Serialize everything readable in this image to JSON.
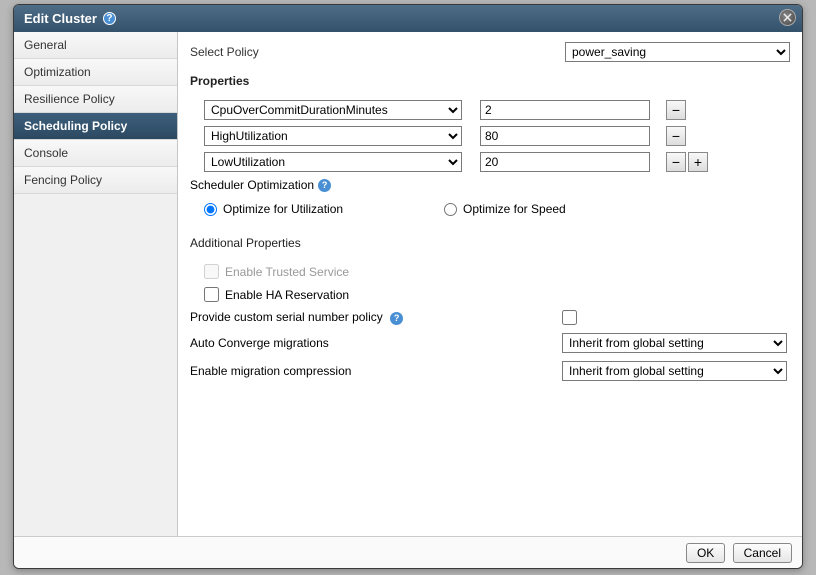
{
  "dialog": {
    "title": "Edit Cluster"
  },
  "sidebar": {
    "items": [
      {
        "label": "General"
      },
      {
        "label": "Optimization"
      },
      {
        "label": "Resilience Policy"
      },
      {
        "label": "Scheduling Policy"
      },
      {
        "label": "Console"
      },
      {
        "label": "Fencing Policy"
      }
    ]
  },
  "content": {
    "select_policy_label": "Select Policy",
    "select_policy_value": "power_saving",
    "properties_title": "Properties",
    "prop_rows": [
      {
        "name": "CpuOverCommitDurationMinutes",
        "value": "2"
      },
      {
        "name": "HighUtilization",
        "value": "80"
      },
      {
        "name": "LowUtilization",
        "value": "20"
      }
    ],
    "scheduler_opt_label": "Scheduler Optimization",
    "radio_utilization": "Optimize for Utilization",
    "radio_speed": "Optimize for Speed",
    "additional_props_title": "Additional Properties",
    "enable_trusted": "Enable Trusted Service",
    "enable_ha": "Enable HA Reservation",
    "provide_serial": "Provide custom serial number policy",
    "auto_converge_label": "Auto Converge migrations",
    "auto_converge_value": "Inherit from global setting",
    "migration_compression_label": "Enable migration compression",
    "migration_compression_value": "Inherit from global setting"
  },
  "footer": {
    "ok": "OK",
    "cancel": "Cancel"
  },
  "icons": {
    "minus": "−",
    "plus": "+"
  }
}
